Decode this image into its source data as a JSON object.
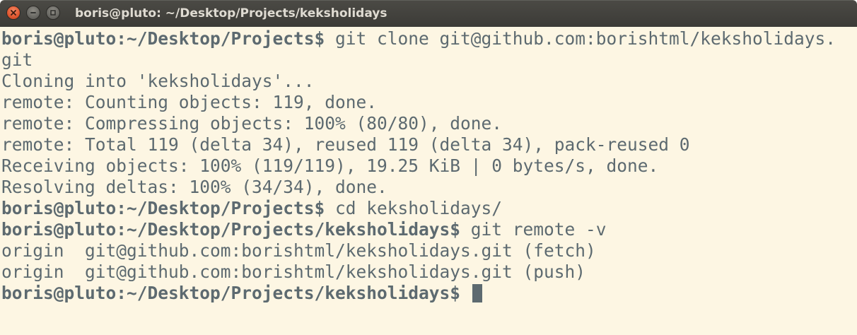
{
  "window": {
    "title": "boris@pluto: ~/Desktop/Projects/keksholidays"
  },
  "colors": {
    "terminal_background": "#fdf6e3",
    "terminal_text": "#5d6a70",
    "titlebar": "#3c3b37",
    "close_button": "#e0562f"
  },
  "terminal": {
    "lines": [
      {
        "prompt_user": "boris@pluto",
        "prompt_sep": ":",
        "prompt_path": "~/Desktop/Projects$",
        "command": " git clone git@github.com:borishtml/keksholidays."
      },
      {
        "output": "git"
      },
      {
        "output": "Cloning into 'keksholidays'..."
      },
      {
        "output": "remote: Counting objects: 119, done."
      },
      {
        "output": "remote: Compressing objects: 100% (80/80), done."
      },
      {
        "output": "remote: Total 119 (delta 34), reused 119 (delta 34), pack-reused 0"
      },
      {
        "output": "Receiving objects: 100% (119/119), 19.25 KiB | 0 bytes/s, done."
      },
      {
        "output": "Resolving deltas: 100% (34/34), done."
      },
      {
        "prompt_user": "boris@pluto",
        "prompt_sep": ":",
        "prompt_path": "~/Desktop/Projects$",
        "command": " cd keksholidays/"
      },
      {
        "prompt_user": "boris@pluto",
        "prompt_sep": ":",
        "prompt_path": "~/Desktop/Projects/keksholidays$",
        "command": " git remote -v"
      },
      {
        "output": "origin  git@github.com:borishtml/keksholidays.git (fetch)"
      },
      {
        "output": "origin  git@github.com:borishtml/keksholidays.git (push)"
      },
      {
        "prompt_user": "boris@pluto",
        "prompt_sep": ":",
        "prompt_path": "~/Desktop/Projects/keksholidays$",
        "command": " "
      }
    ]
  }
}
